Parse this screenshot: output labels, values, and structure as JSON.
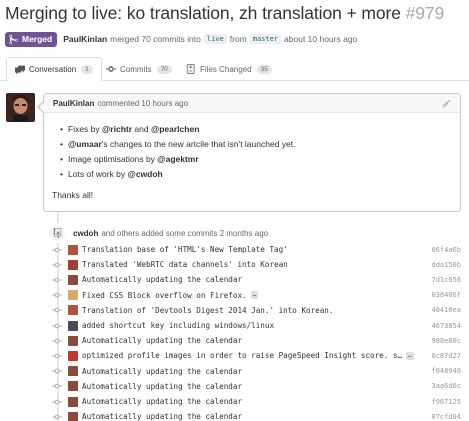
{
  "pr": {
    "title": "Merging to live: ko translation, zh translation + more",
    "number": "#979",
    "state": "Merged",
    "author": "PaulKinlan",
    "merged_text": "merged 70 commits into",
    "base_branch": "live",
    "from_text": "from",
    "head_branch": "master",
    "time": "about 10 hours ago"
  },
  "tabs": [
    {
      "label": "Conversation",
      "count": "1"
    },
    {
      "label": "Commits",
      "count": "70"
    },
    {
      "label": "Files Changed",
      "count": "35"
    }
  ],
  "comment": {
    "author": "PaulKinlan",
    "time_text": "commented 10 hours ago",
    "items": [
      {
        "pre": "Fixes by ",
        "u1": "@richtr",
        "mid": " and ",
        "u2": "@pearlchen",
        "post": ""
      },
      {
        "pre": "",
        "u1": "@umaar",
        "mid": "'s changes to the new artcile that isn't launched yet.",
        "u2": "",
        "post": ""
      },
      {
        "pre": "Image optimisations by ",
        "u1": "@agektmr",
        "mid": "",
        "u2": "",
        "post": ""
      },
      {
        "pre": "Lots of work by ",
        "u1": "@cwdoh",
        "mid": "",
        "u2": "",
        "post": ""
      }
    ],
    "closing": "Thanks all!"
  },
  "event": {
    "who": "cwdoh",
    "text": "and others added some commits 2 months ago"
  },
  "commits": [
    {
      "message": "Translation base of 'HTML's New Template Tag'",
      "sha": "06f4a6b",
      "truncated": false,
      "avatar_color": "#b5523b"
    },
    {
      "message": "Translated 'WebRTC data channels' into Korean",
      "sha": "dda150b",
      "truncated": false,
      "avatar_color": "#a04030"
    },
    {
      "message": "Automatically updating the calendar",
      "sha": "7d1c656",
      "truncated": false,
      "avatar_color": "#8a4a3a"
    },
    {
      "message": "Fixed CSS Block overflow on Firefox.",
      "sha": "038406f",
      "truncated": true,
      "avatar_color": "#d8a86a"
    },
    {
      "message": "Translation of 'Devtools Digest 2014 Jan.' into Korean.",
      "sha": "40410ea",
      "truncated": false,
      "avatar_color": "#b5523b"
    },
    {
      "message": "added shortcut key including windows/linux",
      "sha": "4673854",
      "truncated": false,
      "avatar_color": "#4a4a5a"
    },
    {
      "message": "Automatically updating the calendar",
      "sha": "988e80c",
      "truncated": false,
      "avatar_color": "#8a4a3a"
    },
    {
      "message": "optimized profile images in order to raise PageSpeed Insight score. s…",
      "sha": "0c87d27",
      "truncated": true,
      "avatar_color": "#c0392b"
    },
    {
      "message": "Automatically updating the calendar",
      "sha": "f048940",
      "truncated": false,
      "avatar_color": "#8a4a3a"
    },
    {
      "message": "Automatically updating the calendar",
      "sha": "3aa6d6c",
      "truncated": false,
      "avatar_color": "#8a4a3a"
    },
    {
      "message": "Automatically updating the calendar",
      "sha": "f967125",
      "truncated": false,
      "avatar_color": "#8a4a3a"
    },
    {
      "message": "Automatically updating the calendar",
      "sha": "07cfd94",
      "truncated": false,
      "avatar_color": "#8a4a3a"
    }
  ],
  "colors": {
    "merged": "#6e5494",
    "link": "#4183c4"
  },
  "icons": {
    "state": "git-merge-icon",
    "conversation": "comment-discussion-icon",
    "commits": "git-commit-icon",
    "files": "diff-icon",
    "edit": "pencil-icon",
    "event": "repo-push-icon",
    "commit_dot": "git-commit-icon"
  }
}
